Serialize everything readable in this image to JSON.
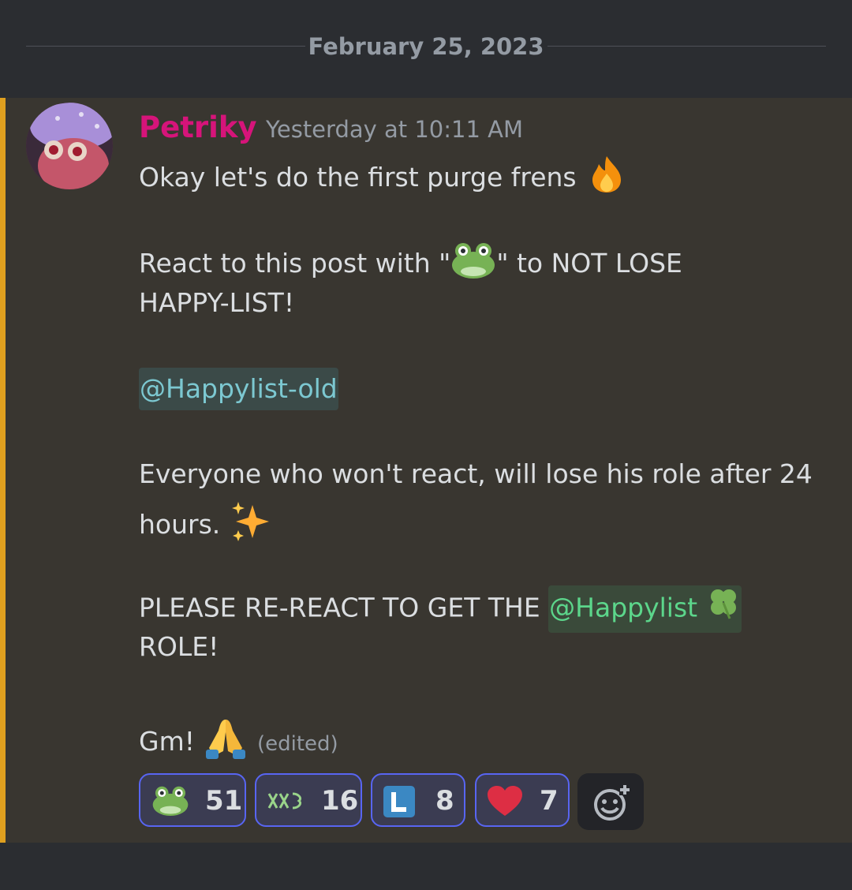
{
  "date_divider": "February 25, 2023",
  "message": {
    "author": "Petriky",
    "timestamp": "Yesterday at 10:11 AM",
    "lines": {
      "l1": "Okay let's do the first purge frens",
      "l2a": "React to this post with \"",
      "l2b": "\" to NOT LOSE",
      "l3": "HAPPY-LIST!",
      "mention_old": "@Happylist-old",
      "l5": "Everyone who won't react, will lose his role after 24",
      "l6": "hours.",
      "l7a": "PLEASE RE-REACT TO GET THE ",
      "mention_green": "@Happylist",
      "l8": "ROLE!",
      "l9": "Gm!",
      "edited": "(edited)"
    },
    "emojis": [
      "fire",
      "frog",
      "sparkles",
      "four-leaf-clover",
      "folded-hands"
    ]
  },
  "reactions": [
    {
      "emoji": "frog",
      "count": "51"
    },
    {
      "emoji": "custom-green-text",
      "count": "16"
    },
    {
      "emoji": "letter-l",
      "count": "8"
    },
    {
      "emoji": "red-heart",
      "count": "7"
    }
  ],
  "colors": {
    "accent": "#5865f2",
    "username": "#d6147a",
    "highlight_bar": "#e0a01f",
    "mention_old": "#7cc8d1",
    "mention_green": "#5cd68b"
  }
}
